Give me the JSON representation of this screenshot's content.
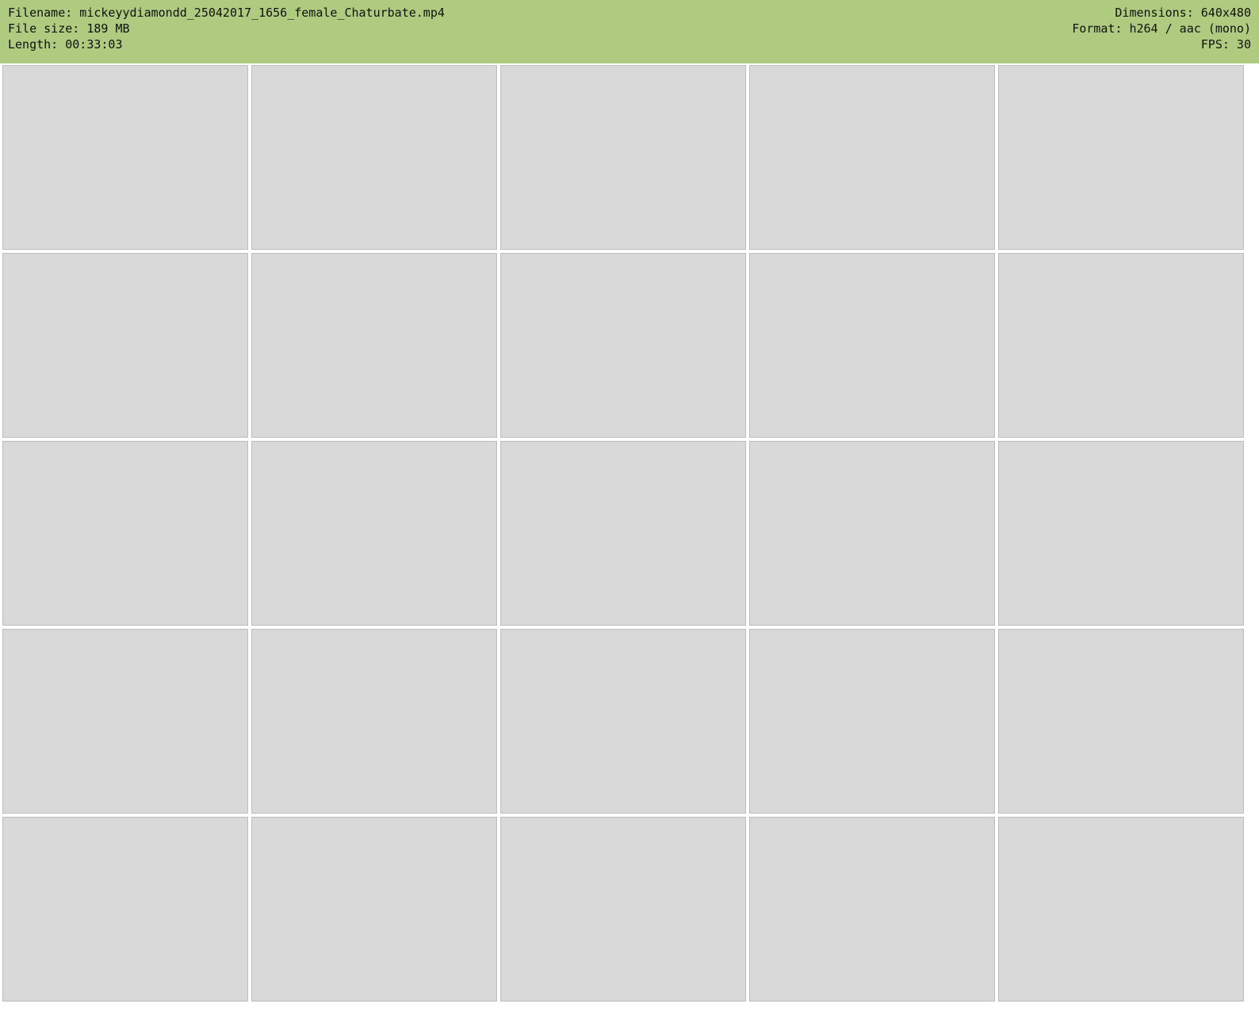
{
  "header": {
    "left": [
      "Filename: mickeyydiamondd_25042017_1656_female_Chaturbate.mp4",
      "File size: 189 MB",
      "Length: 00:33:03"
    ],
    "right": [
      "Dimensions: 640x480",
      "Format: h264 / aac (mono)",
      "FPS: 30"
    ]
  },
  "grid": {
    "tile_count": 25
  }
}
